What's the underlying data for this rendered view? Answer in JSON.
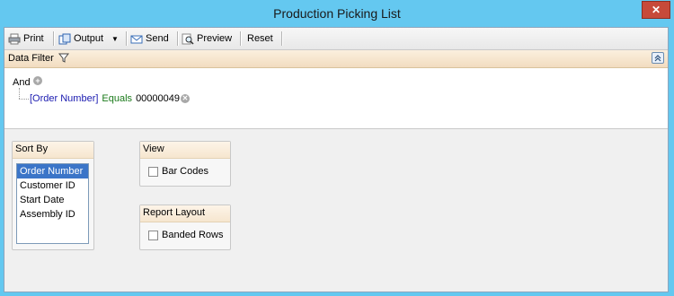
{
  "window": {
    "title": "Production Picking List",
    "close_label": "✕"
  },
  "toolbar": {
    "print_label": "Print",
    "output_label": "Output",
    "send_label": "Send",
    "preview_label": "Preview",
    "reset_label": "Reset"
  },
  "filter_bar": {
    "label": "Data Filter"
  },
  "filter": {
    "group_operator": "And",
    "condition": {
      "field": "[Order Number]",
      "operator": "Equals",
      "value": "00000049"
    }
  },
  "sort_by": {
    "title": "Sort By",
    "options": [
      "Order Number",
      "Customer ID",
      "Start Date",
      "Assembly ID"
    ],
    "selected_index": 0
  },
  "view": {
    "title": "View",
    "bar_codes_label": "Bar Codes",
    "bar_codes_checked": false
  },
  "report_layout": {
    "title": "Report Layout",
    "banded_rows_label": "Banded Rows",
    "banded_rows_checked": false
  },
  "colors": {
    "title_bar": "#64c8f0",
    "selection": "#3b75c8",
    "field_text": "#1a1ab0",
    "operator_text": "#1a7a1a"
  }
}
